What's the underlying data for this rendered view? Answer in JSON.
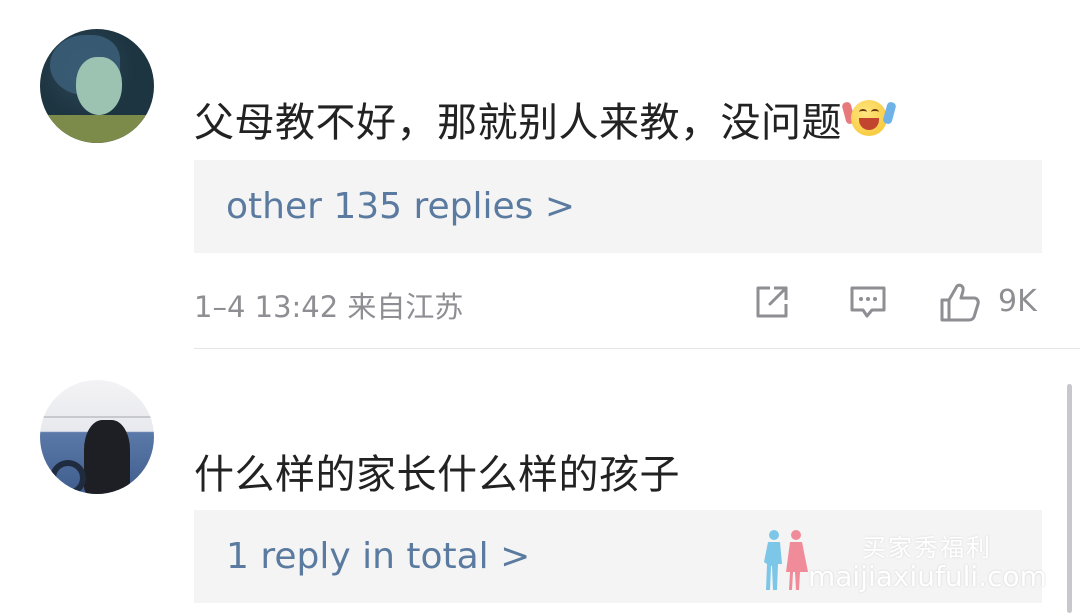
{
  "comments": [
    {
      "text": "父母教不好，那就别人来教，没问题",
      "emoji": "laughing-emoji",
      "replies_label": "other 135 replies >",
      "time": "1–4 13:42",
      "location": "来自江苏",
      "likes": "9K"
    },
    {
      "text": "什么样的家长什么样的孩子",
      "replies_label": "1 reply in total >"
    }
  ],
  "icons": {
    "share": "share-icon",
    "comment": "comment-icon",
    "like": "thumbs-up-icon"
  },
  "watermark": {
    "line1": "买家秀福利",
    "line2": "maijiaxiufuli.com"
  },
  "colors": {
    "link": "#5a7a9f",
    "meta": "#8e8e93",
    "reply_bg": "#f4f4f5",
    "watermark_blue": "#7cc6e8",
    "watermark_pink": "#f08c9a"
  }
}
